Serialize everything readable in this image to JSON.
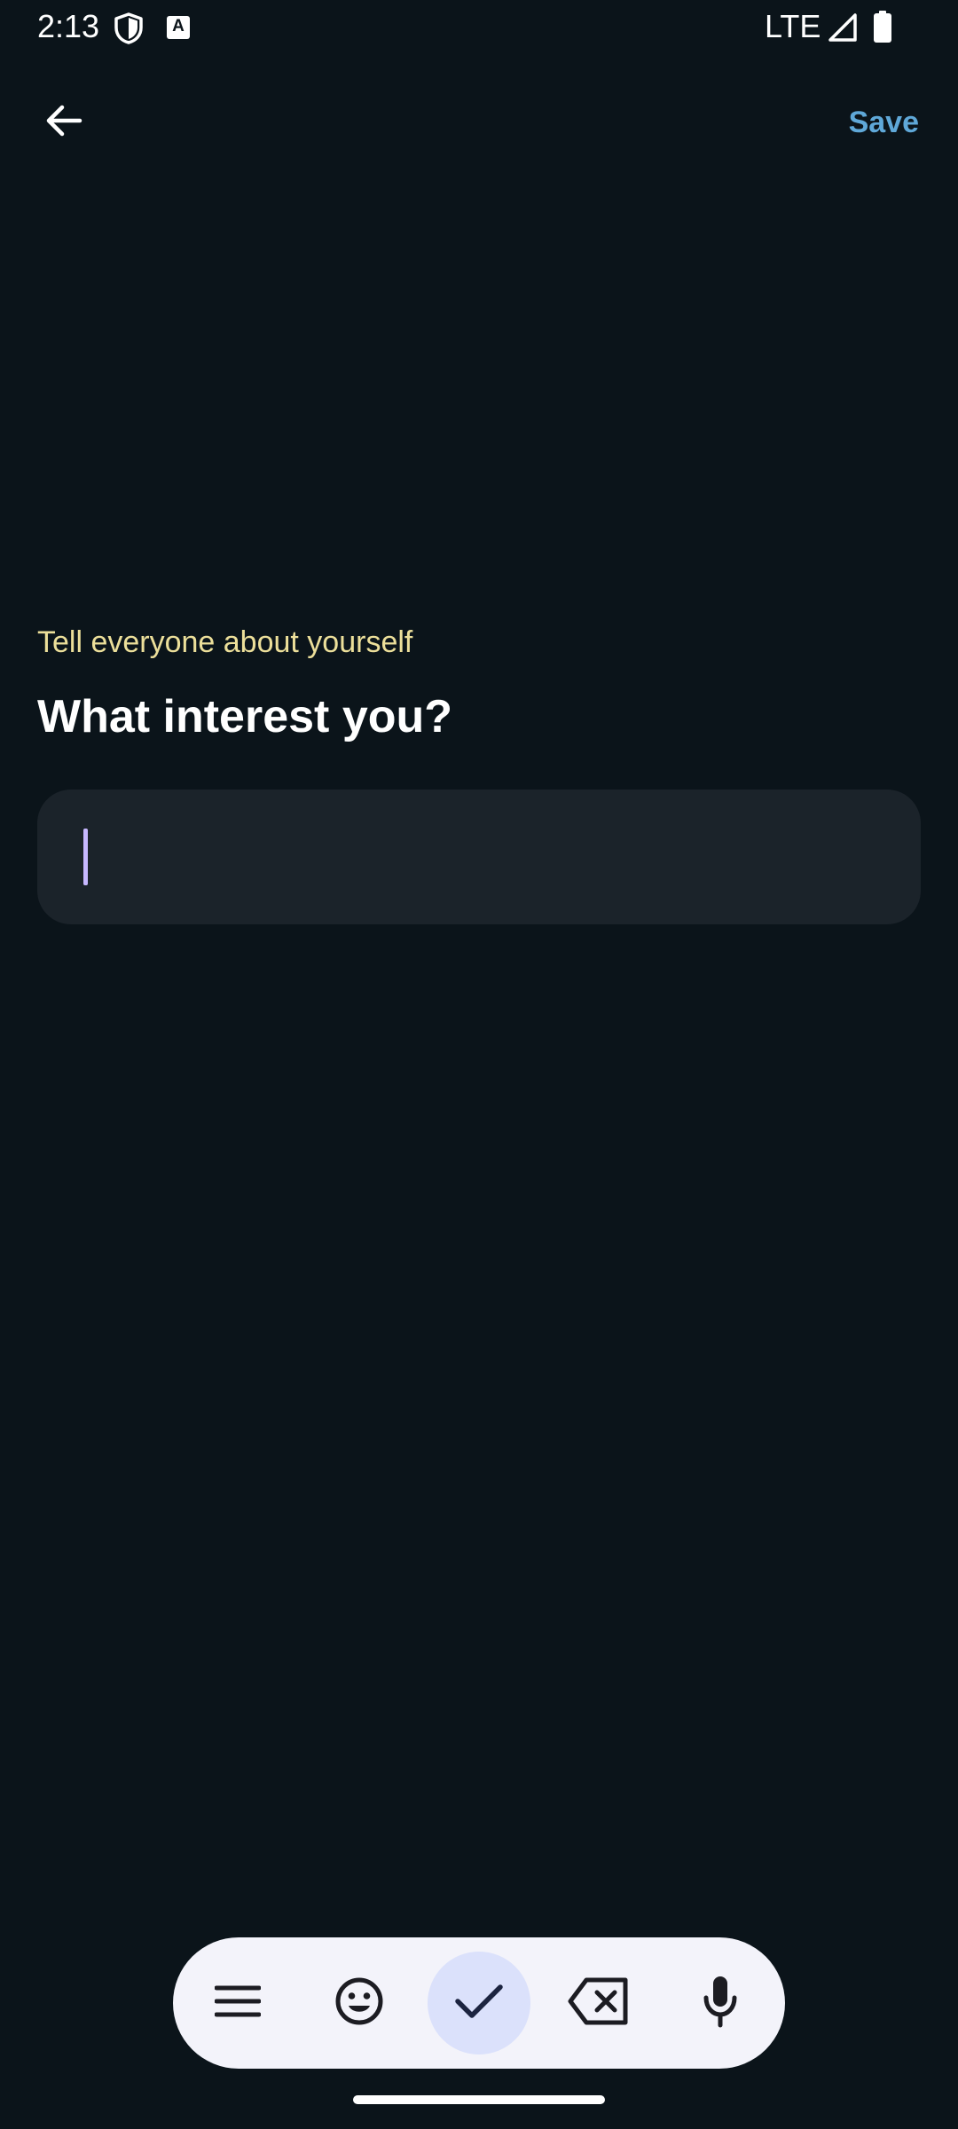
{
  "status_bar": {
    "time": "2:13",
    "network": "LTE",
    "keyboard_badge": "A",
    "icons": [
      "shield-icon",
      "keyboard-icon",
      "signal-icon",
      "battery-icon"
    ]
  },
  "app_bar": {
    "back_icon": "arrow-back-icon",
    "save_label": "Save"
  },
  "prompt": {
    "subtitle": "Tell everyone about yourself",
    "title": "What interest you?"
  },
  "input": {
    "value": "",
    "placeholder": ""
  },
  "keyboard_toolbar": {
    "items": [
      "menu-icon",
      "emoji-icon",
      "check-icon",
      "backspace-icon",
      "mic-icon"
    ]
  },
  "colors": {
    "background": "#0b141a",
    "accent": "#5fa8d8",
    "subtitle": "#ecdf9a",
    "input_bg": "#1b232a",
    "caret": "#c7b8ff",
    "toolbar_bg": "#f3f3fa",
    "check_bg": "#dbe1fb"
  }
}
